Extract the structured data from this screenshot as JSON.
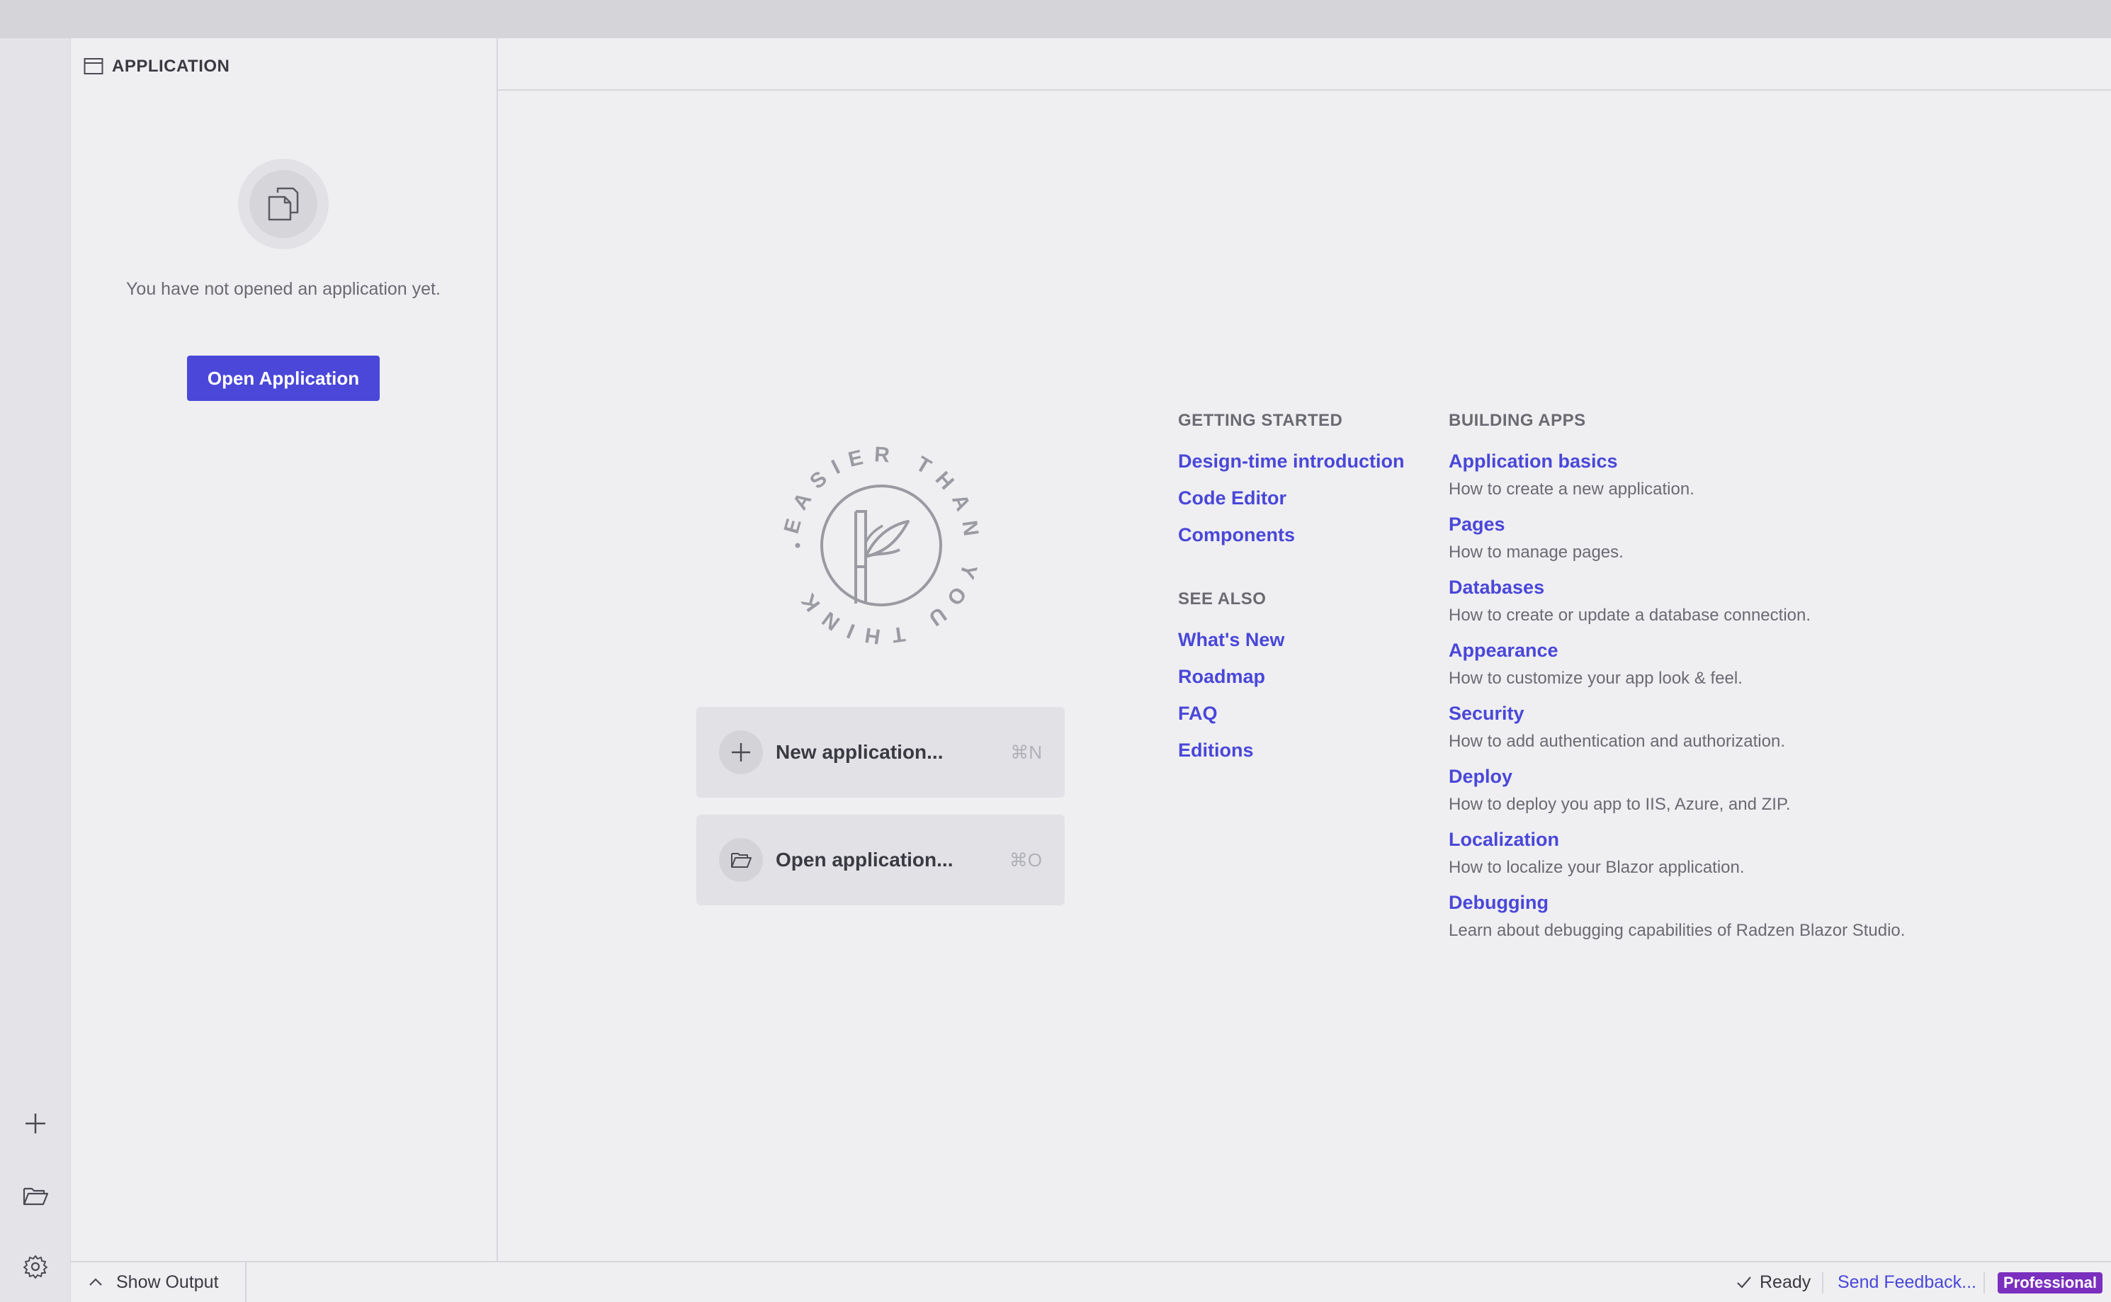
{
  "sidebar": {
    "header": "APPLICATION",
    "empty_text": "You have not opened an application yet.",
    "open_button": "Open Application"
  },
  "activity_bar": {
    "icons": [
      "plus-icon",
      "folder-open-icon",
      "gear-icon"
    ]
  },
  "logo": {
    "ring_text": "EASIER THAN YOU THINK"
  },
  "actions": [
    {
      "label": "New application...",
      "shortcut": "⌘N",
      "icon": "plus-icon"
    },
    {
      "label": "Open application...",
      "shortcut": "⌘O",
      "icon": "folder-open-icon"
    }
  ],
  "getting_started": {
    "title": "GETTING STARTED",
    "links": [
      "Design-time introduction",
      "Code Editor",
      "Components"
    ]
  },
  "see_also": {
    "title": "SEE ALSO",
    "links": [
      "What's New",
      "Roadmap",
      "FAQ",
      "Editions"
    ]
  },
  "building_apps": {
    "title": "BUILDING APPS",
    "items": [
      {
        "title": "Application basics",
        "desc": "How to create a new application."
      },
      {
        "title": "Pages",
        "desc": "How to manage pages."
      },
      {
        "title": "Databases",
        "desc": "How to create or update a database connection."
      },
      {
        "title": "Appearance",
        "desc": "How to customize your app look & feel."
      },
      {
        "title": "Security",
        "desc": "How to add authentication and authorization."
      },
      {
        "title": "Deploy",
        "desc": "How to deploy you app to IIS, Azure, and ZIP."
      },
      {
        "title": "Localization",
        "desc": "How to localize your Blazor application."
      },
      {
        "title": "Debugging",
        "desc": "Learn about debugging capabilities of Radzen Blazor Studio."
      }
    ]
  },
  "statusbar": {
    "show_output": "Show Output",
    "status": "Ready",
    "feedback": "Send Feedback...",
    "edition_badge": "Professional"
  },
  "colors": {
    "accent": "#4a47d9",
    "badge": "#7b2fbe",
    "background": "#efeff1"
  }
}
